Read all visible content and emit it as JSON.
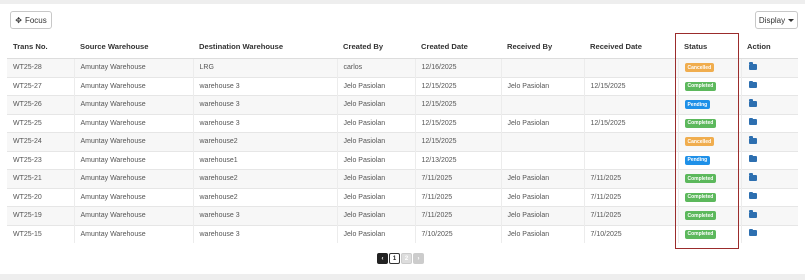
{
  "toolbar": {
    "focus_label": "Focus",
    "display_label": "Display"
  },
  "table": {
    "headers": [
      "Trans No.",
      "Source Warehouse",
      "Destination Warehouse",
      "Created By",
      "Created Date",
      "Received By",
      "Received Date",
      "Status",
      "Action"
    ],
    "rows": [
      {
        "trans_no": "WT25-28",
        "source": "Amuntay Warehouse",
        "destination": "LRG",
        "created_by": "carlos",
        "created_date": "12/16/2025",
        "received_by": "",
        "received_date": "",
        "status": "Cancelled"
      },
      {
        "trans_no": "WT25-27",
        "source": "Amuntay Warehouse",
        "destination": "warehouse 3",
        "created_by": "Jelo Pasiolan",
        "created_date": "12/15/2025",
        "received_by": "Jelo Pasiolan",
        "received_date": "12/15/2025",
        "status": "Completed"
      },
      {
        "trans_no": "WT25-26",
        "source": "Amuntay Warehouse",
        "destination": "warehouse 3",
        "created_by": "Jelo Pasiolan",
        "created_date": "12/15/2025",
        "received_by": "",
        "received_date": "",
        "status": "Pending"
      },
      {
        "trans_no": "WT25-25",
        "source": "Amuntay Warehouse",
        "destination": "warehouse 3",
        "created_by": "Jelo Pasiolan",
        "created_date": "12/15/2025",
        "received_by": "Jelo Pasiolan",
        "received_date": "12/15/2025",
        "status": "Completed"
      },
      {
        "trans_no": "WT25-24",
        "source": "Amuntay Warehouse",
        "destination": "warehouse2",
        "created_by": "Jelo Pasiolan",
        "created_date": "12/15/2025",
        "received_by": "",
        "received_date": "",
        "status": "Cancelled"
      },
      {
        "trans_no": "WT25-23",
        "source": "Amuntay Warehouse",
        "destination": "warehouse1",
        "created_by": "Jelo Pasiolan",
        "created_date": "12/13/2025",
        "received_by": "",
        "received_date": "",
        "status": "Pending"
      },
      {
        "trans_no": "WT25-21",
        "source": "Amuntay Warehouse",
        "destination": "warehouse2",
        "created_by": "Jelo Pasiolan",
        "created_date": "7/11/2025",
        "received_by": "Jelo Pasiolan",
        "received_date": "7/11/2025",
        "status": "Completed"
      },
      {
        "trans_no": "WT25-20",
        "source": "Amuntay Warehouse",
        "destination": "warehouse2",
        "created_by": "Jelo Pasiolan",
        "created_date": "7/11/2025",
        "received_by": "Jelo Pasiolan",
        "received_date": "7/11/2025",
        "status": "Completed"
      },
      {
        "trans_no": "WT25-19",
        "source": "Amuntay Warehouse",
        "destination": "warehouse 3",
        "created_by": "Jelo Pasiolan",
        "created_date": "7/11/2025",
        "received_by": "Jelo Pasiolan",
        "received_date": "7/11/2025",
        "status": "Completed"
      },
      {
        "trans_no": "WT25-15",
        "source": "Amuntay Warehouse",
        "destination": "warehouse 3",
        "created_by": "Jelo Pasiolan",
        "created_date": "7/10/2025",
        "received_by": "Jelo Pasiolan",
        "received_date": "7/10/2025",
        "status": "Completed"
      }
    ]
  },
  "status_colors": {
    "Cancelled": "#f0ad4e",
    "Completed": "#5cb85c",
    "Pending": "#1e90e8"
  },
  "action_icon": "folder-open-icon",
  "pagination": {
    "prev": "‹",
    "pages": [
      "1",
      "2"
    ],
    "current": "1",
    "next": "›"
  }
}
